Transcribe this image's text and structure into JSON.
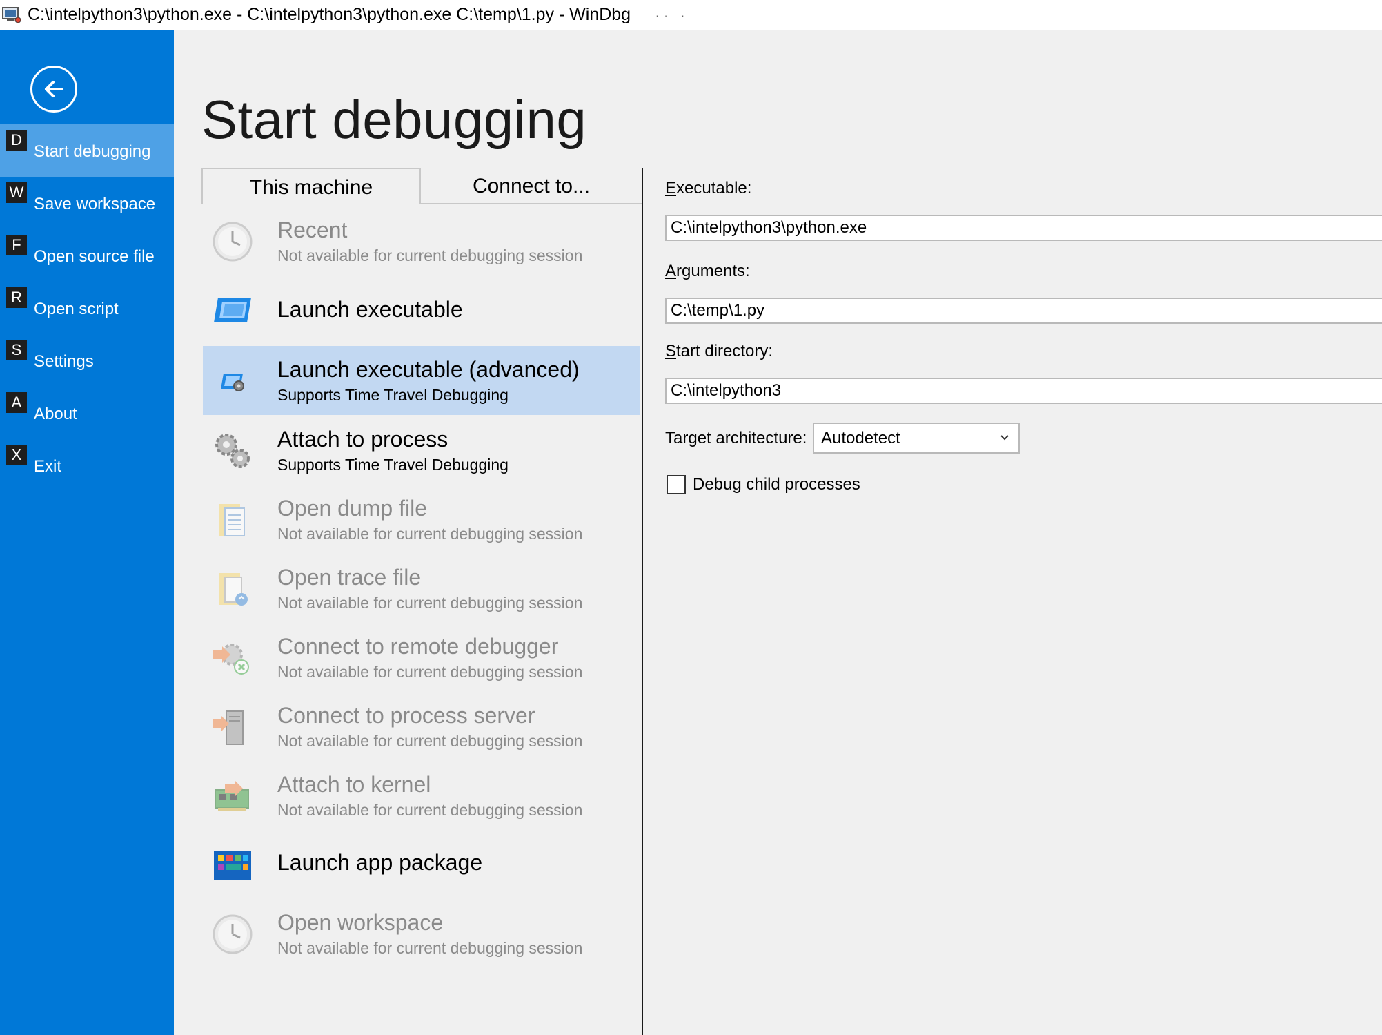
{
  "window": {
    "title": "C:\\intelpython3\\python.exe - C:\\intelpython3\\python.exe C:\\temp\\1.py - WinDbg",
    "title_suffix": "·· ·"
  },
  "sidebar": {
    "items": [
      {
        "key": "D",
        "label": "Start debugging",
        "active": true
      },
      {
        "key": "W",
        "label": "Save workspace"
      },
      {
        "key": "F",
        "label": "Open source file"
      },
      {
        "key": "R",
        "label": "Open script"
      },
      {
        "key": "S",
        "label": "Settings"
      },
      {
        "key": "A",
        "label": "About"
      },
      {
        "key": "X",
        "label": "Exit"
      }
    ]
  },
  "main": {
    "title": "Start debugging",
    "tabs": [
      {
        "label": "This machine",
        "active": true
      },
      {
        "label": "Connect to..."
      }
    ],
    "options": [
      {
        "title": "Recent",
        "subtitle": "Not available for current debugging session",
        "icon": "clock-icon",
        "enabled": false
      },
      {
        "title": "Launch executable",
        "subtitle": "",
        "icon": "window-icon",
        "enabled": true
      },
      {
        "title": "Launch executable (advanced)",
        "subtitle": "Supports Time Travel Debugging",
        "icon": "window-gear-icon",
        "enabled": true,
        "selected": true
      },
      {
        "title": "Attach to process",
        "subtitle": "Supports Time Travel Debugging",
        "icon": "gears-icon",
        "enabled": true
      },
      {
        "title": "Open dump file",
        "subtitle": "Not available for current debugging session",
        "icon": "folder-document-icon",
        "enabled": false
      },
      {
        "title": "Open trace file",
        "subtitle": "Not available for current debugging session",
        "icon": "folder-trace-icon",
        "enabled": false
      },
      {
        "title": "Connect to remote debugger",
        "subtitle": "Not available for current debugging session",
        "icon": "remote-debugger-icon",
        "enabled": false
      },
      {
        "title": "Connect to process server",
        "subtitle": "Not available for current debugging session",
        "icon": "server-icon",
        "enabled": false
      },
      {
        "title": "Attach to kernel",
        "subtitle": "Not available for current debugging session",
        "icon": "circuit-board-icon",
        "enabled": false
      },
      {
        "title": "Launch app package",
        "subtitle": "",
        "icon": "app-package-icon",
        "enabled": true
      },
      {
        "title": "Open workspace",
        "subtitle": "Not available for current debugging session",
        "icon": "clock-icon",
        "enabled": false
      }
    ]
  },
  "form": {
    "executable": {
      "label_ul": "E",
      "label_rest": "xecutable:",
      "value": "C:\\intelpython3\\python.exe"
    },
    "arguments": {
      "label_ul": "A",
      "label_rest": "rguments:",
      "value": "C:\\temp\\1.py"
    },
    "start_directory": {
      "label_ul": "S",
      "label_rest": "tart directory:",
      "value": "C:\\intelpython3"
    },
    "target_architecture": {
      "label": "Target architecture:",
      "value": "Autodetect"
    },
    "debug_child": {
      "label": "Debug child processes",
      "checked": false
    }
  },
  "colors": {
    "sidebar": "#0078d7",
    "sidebar_active": "#4ea1e6",
    "selected_option": "#c2d8f2",
    "disabled_text": "#8a8a8a"
  }
}
